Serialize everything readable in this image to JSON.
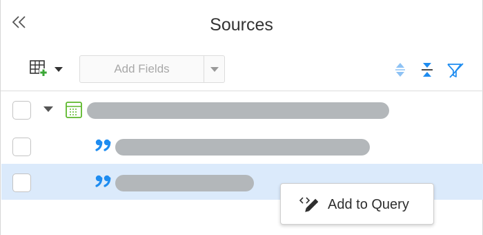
{
  "header": {
    "title": "Sources"
  },
  "toolbar": {
    "add_fields_placeholder": "Add Fields",
    "icons": [
      "table-add-icon",
      "caret-down-icon",
      "expand-all-icon",
      "collapse-all-icon",
      "filter-icon"
    ]
  },
  "tree": {
    "rows": [
      {
        "type": "table",
        "expanded": true,
        "selected": false
      },
      {
        "type": "field",
        "selected": false
      },
      {
        "type": "field",
        "selected": true
      }
    ]
  },
  "context_menu": {
    "items": [
      {
        "label": "Add to Query",
        "icon": "add-to-query-icon"
      }
    ]
  },
  "colors": {
    "accent_blue": "#1e8cf0",
    "selected_row": "#dbeafb",
    "table_icon_green": "#5cb82a",
    "placeholder_bar": "#b3b7ba"
  }
}
